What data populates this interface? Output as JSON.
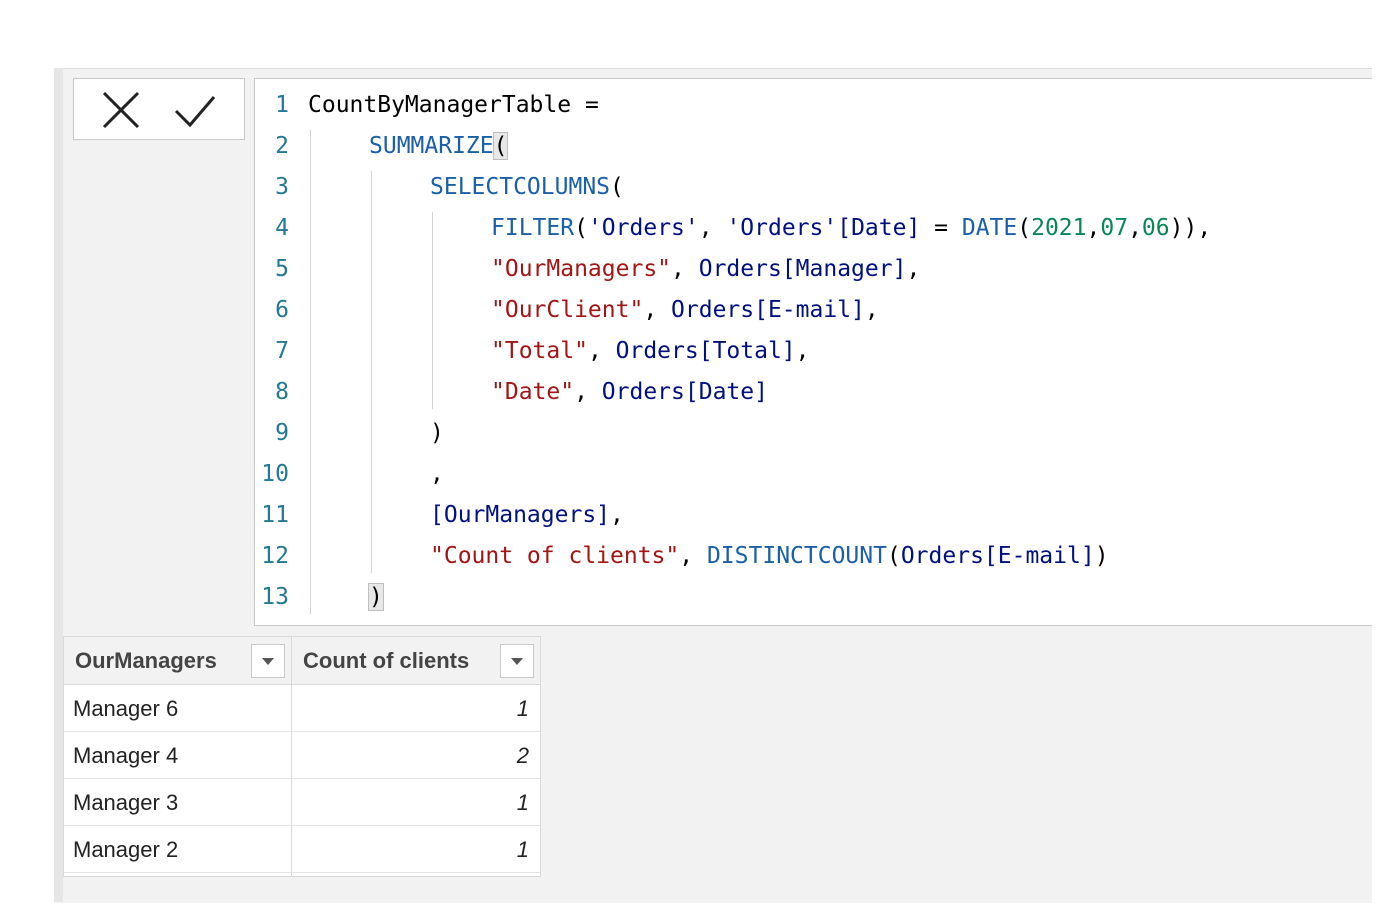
{
  "formula_bar": {
    "cancel_icon": "x-icon",
    "commit_icon": "check-icon",
    "lines": [
      {
        "n": "1",
        "tokens": [
          {
            "t": "CountByManagerTable =",
            "c": "plain"
          }
        ]
      },
      {
        "n": "2",
        "tokens": [
          {
            "t": "SUMMARIZE",
            "c": "kw"
          },
          {
            "t": "(",
            "c": "plain",
            "m": true
          }
        ]
      },
      {
        "n": "3",
        "tokens": [
          {
            "t": "SELECTCOLUMNS",
            "c": "kw"
          },
          {
            "t": "(",
            "c": "plain"
          }
        ]
      },
      {
        "n": "4",
        "tokens": [
          {
            "t": "FILTER",
            "c": "kw"
          },
          {
            "t": "(",
            "c": "plain"
          },
          {
            "t": "'Orders'",
            "c": "ref"
          },
          {
            "t": ", ",
            "c": "plain"
          },
          {
            "t": "'Orders'",
            "c": "ref"
          },
          {
            "t": "[Date]",
            "c": "ref"
          },
          {
            "t": " = ",
            "c": "plain"
          },
          {
            "t": "DATE",
            "c": "kw"
          },
          {
            "t": "(",
            "c": "plain"
          },
          {
            "t": "2021",
            "c": "num"
          },
          {
            "t": ",",
            "c": "plain"
          },
          {
            "t": "07",
            "c": "num"
          },
          {
            "t": ",",
            "c": "plain"
          },
          {
            "t": "06",
            "c": "num"
          },
          {
            "t": ")),",
            "c": "plain"
          }
        ]
      },
      {
        "n": "5",
        "tokens": [
          {
            "t": "\"OurManagers\"",
            "c": "str"
          },
          {
            "t": ", ",
            "c": "plain"
          },
          {
            "t": "Orders[Manager]",
            "c": "ref"
          },
          {
            "t": ",",
            "c": "plain"
          }
        ]
      },
      {
        "n": "6",
        "tokens": [
          {
            "t": "\"OurClient\"",
            "c": "str"
          },
          {
            "t": ", ",
            "c": "plain"
          },
          {
            "t": "Orders[E-mail]",
            "c": "ref"
          },
          {
            "t": ",",
            "c": "plain"
          }
        ]
      },
      {
        "n": "7",
        "tokens": [
          {
            "t": "\"Total\"",
            "c": "str"
          },
          {
            "t": ", ",
            "c": "plain"
          },
          {
            "t": "Orders[Total]",
            "c": "ref"
          },
          {
            "t": ",",
            "c": "plain"
          }
        ]
      },
      {
        "n": "8",
        "tokens": [
          {
            "t": "\"Date\"",
            "c": "str"
          },
          {
            "t": ", ",
            "c": "plain"
          },
          {
            "t": "Orders[Date]",
            "c": "ref"
          }
        ]
      },
      {
        "n": "9",
        "tokens": [
          {
            "t": ")",
            "c": "plain"
          }
        ]
      },
      {
        "n": "10",
        "tokens": [
          {
            "t": ",",
            "c": "plain"
          }
        ]
      },
      {
        "n": "11",
        "tokens": [
          {
            "t": "[OurManagers]",
            "c": "ref"
          },
          {
            "t": ",",
            "c": "plain"
          }
        ]
      },
      {
        "n": "12",
        "tokens": [
          {
            "t": "\"Count of clients\"",
            "c": "str"
          },
          {
            "t": ", ",
            "c": "plain"
          },
          {
            "t": "DISTINCTCOUNT",
            "c": "kw"
          },
          {
            "t": "(",
            "c": "plain"
          },
          {
            "t": "Orders[E-mail]",
            "c": "ref"
          },
          {
            "t": ")",
            "c": "plain"
          }
        ]
      },
      {
        "n": "13",
        "tokens": [
          {
            "t": ")",
            "c": "plain",
            "m": true
          }
        ]
      }
    ]
  },
  "table": {
    "columns": [
      {
        "label": "OurManagers",
        "filter_icon": "dropdown-arrow-icon"
      },
      {
        "label": "Count of clients",
        "filter_icon": "dropdown-arrow-icon"
      }
    ],
    "rows": [
      {
        "manager": "Manager 6",
        "count": "1"
      },
      {
        "manager": "Manager 4",
        "count": "2"
      },
      {
        "manager": "Manager 3",
        "count": "1"
      },
      {
        "manager": "Manager 2",
        "count": "1"
      }
    ]
  },
  "colors": {
    "keyword": "#1a5fa8",
    "string": "#a31515",
    "number": "#098658",
    "reference": "#001080",
    "line_number": "#237893"
  }
}
